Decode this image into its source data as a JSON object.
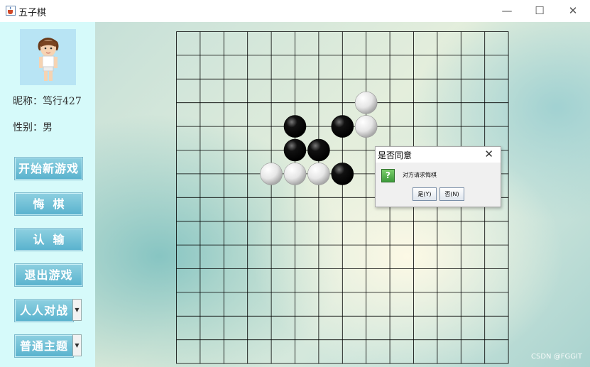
{
  "window": {
    "title": "五子棋",
    "icon": "java-cup-icon",
    "controls": {
      "minimize": "—",
      "maximize": "☐",
      "close": "✕"
    }
  },
  "player": {
    "nickname_label": "昵称：",
    "nickname": "笃行427",
    "gender_label": "性别：",
    "gender": "男"
  },
  "sidebar": {
    "buttons": [
      {
        "id": "new-game",
        "label": "开始新游戏"
      },
      {
        "id": "undo",
        "label": "悔棋"
      },
      {
        "id": "resign",
        "label": "认输"
      },
      {
        "id": "exit",
        "label": "退出游戏"
      }
    ],
    "mode_select": {
      "value": "人人对战"
    },
    "theme_select": {
      "value": "普通主题"
    }
  },
  "board": {
    "size": 15,
    "stones": [
      {
        "col": 8,
        "row": 3,
        "color": "white"
      },
      {
        "col": 5,
        "row": 4,
        "color": "black"
      },
      {
        "col": 7,
        "row": 4,
        "color": "black"
      },
      {
        "col": 8,
        "row": 4,
        "color": "white"
      },
      {
        "col": 5,
        "row": 5,
        "color": "black"
      },
      {
        "col": 6,
        "row": 5,
        "color": "black"
      },
      {
        "col": 4,
        "row": 6,
        "color": "white"
      },
      {
        "col": 5,
        "row": 6,
        "color": "white"
      },
      {
        "col": 6,
        "row": 6,
        "color": "white"
      },
      {
        "col": 7,
        "row": 6,
        "color": "black"
      }
    ]
  },
  "dialog": {
    "title": "是否同意",
    "close": "✕",
    "icon": "?",
    "message": "对方请求悔棋",
    "yes_label": "是(Y)",
    "no_label": "否(N)"
  },
  "watermark": "CSDN @FGGIT",
  "colors": {
    "sidebar": "#d6fafa",
    "button": "#6fc0d8",
    "grid": "#000000"
  }
}
